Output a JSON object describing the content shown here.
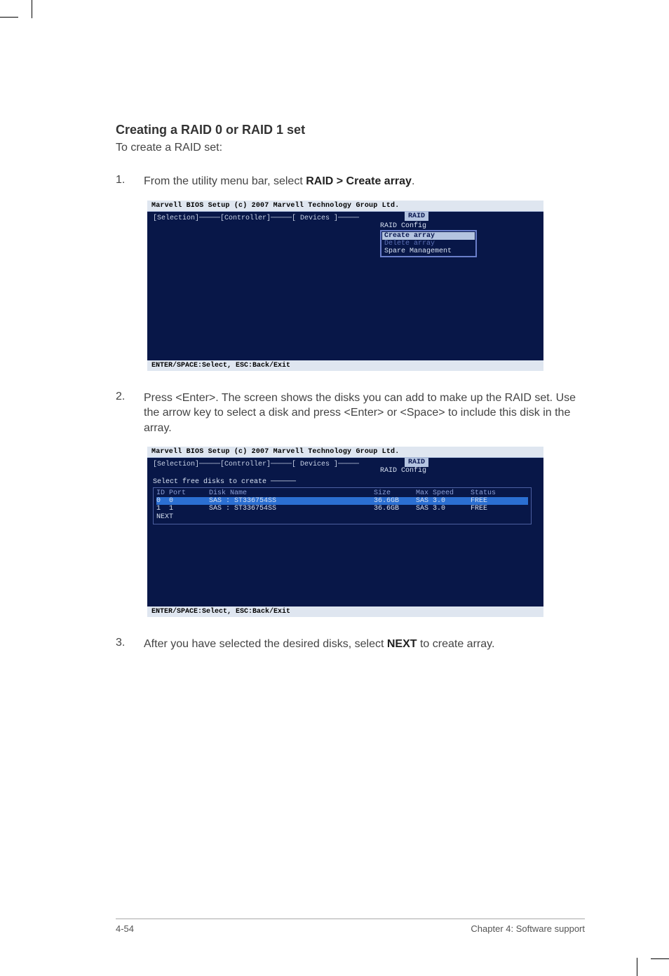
{
  "heading": "Creating a RAID 0 or RAID 1 set",
  "intro": "To create a RAID set:",
  "steps": [
    {
      "num": "1.",
      "prefix": "From the utility menu bar, select ",
      "bold": "RAID > Create array",
      "suffix": "."
    },
    {
      "num": "2.",
      "prefix": "Press <Enter>. The screen shows the disks you can add to make up the RAID set. Use the arrow key to select a disk and press <Enter> or <Space> to include this disk in the array.",
      "bold": "",
      "suffix": ""
    },
    {
      "num": "3.",
      "prefix": "After you have selected the desired disks, select ",
      "bold": "NEXT",
      "suffix": " to create array."
    }
  ],
  "bios": {
    "title": "Marvell BIOS Setup (c) 2007 Marvell Technology Group Ltd.",
    "tabs_line": "[Selection]─────[Controller]─────[ Devices ]─────",
    "raid_tab": "RAID",
    "raid_config": "RAID Config",
    "submenu": {
      "create": "Create array",
      "delete": "Delete array",
      "spare": "Spare Management"
    },
    "footer": "ENTER/SPACE:Select, ESC:Back/Exit"
  },
  "bios2": {
    "title": "Marvell BIOS Setup (c) 2007 Marvell Technology Group Ltd.",
    "tabs_line": "[Selection]─────[Controller]─────[ Devices ]─────",
    "raid_tab": "RAID",
    "raid_config": "RAID Config",
    "select_free": "Select free disks to create ──────",
    "columns": {
      "idport": "ID Port",
      "name": "Disk Name",
      "size": "Size",
      "speed": "Max Speed",
      "status": "Status"
    },
    "rows": [
      {
        "id": "0",
        "port": "0",
        "name": "SAS : ST336754SS",
        "size": "36.6GB",
        "speed": "SAS 3.0",
        "status": "FREE",
        "selected": true
      },
      {
        "id": "1",
        "port": "1",
        "name": "SAS : ST336754SS",
        "size": "36.6GB",
        "speed": "SAS 3.0",
        "status": "FREE",
        "selected": false
      }
    ],
    "next": "NEXT",
    "footer": "ENTER/SPACE:Select, ESC:Back/Exit"
  },
  "footer": {
    "left": "4-54",
    "right": "Chapter 4: Software support"
  }
}
